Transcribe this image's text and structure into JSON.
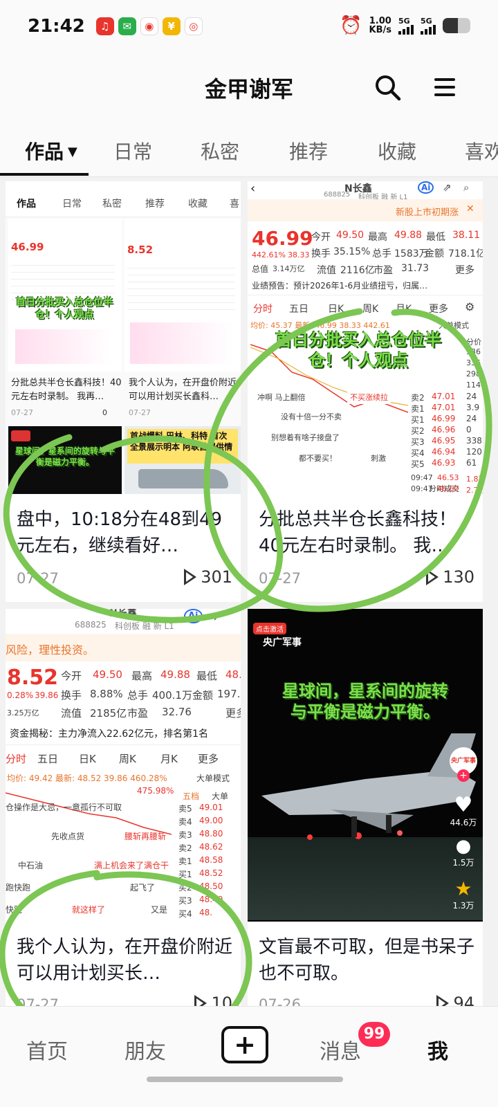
{
  "status_bar": {
    "time": "21:42",
    "net_speed_value": "1.00",
    "net_speed_unit": "KB/s",
    "signal_1": "5G",
    "signal_2": "5G",
    "battery_level": 0.55,
    "app_icons": [
      "qq-music-icon",
      "wechat-icon",
      "map-icon",
      "wallet-icon",
      "weibo-icon"
    ]
  },
  "header": {
    "title": "金甲谢军",
    "search_icon": "search-icon",
    "menu_icon": "menu-icon"
  },
  "tabs": [
    {
      "label": "作品",
      "active": true
    },
    {
      "label": "日常"
    },
    {
      "label": "私密"
    },
    {
      "label": "推荐"
    },
    {
      "label": "收藏"
    },
    {
      "label": "喜欢"
    }
  ],
  "videos": [
    {
      "caption": "盘中，10:18分在48到49元左右，继续看好…",
      "date": "07-27",
      "plays": "301",
      "thumb": {
        "mini_tabs": [
          "作品",
          "日常",
          "私密",
          "推荐",
          "收藏",
          "喜"
        ],
        "left": {
          "price": "46.99",
          "caption": "分批总共半仓长鑫科技！40元左右时录制。 我再…",
          "date": "07-27",
          "plays": "0",
          "overlay": "首日分批买入总仓位半仓！个人观点"
        },
        "right": {
          "price": "8.52",
          "caption": "我个人认为，在开盘价附近可以用计划买长鑫科…",
          "date": "07-27",
          "plays": ""
        },
        "bottom_left_text": "星球间，星系间的旋转与平衡是磁力平衡。",
        "bottom_right_text": "首战爆料 巴林、科特 首次全景展示明本 阿联酋提供情"
      }
    },
    {
      "caption": "分批总共半仓长鑫科技！40元左右时录制。 我…",
      "date": "07-27",
      "plays": "130",
      "thumb": {
        "stock_name": "N长鑫",
        "stock_code": "688825",
        "stock_tags": "科创板 融 新 L1",
        "ipo_notice": "新股上市初期涨",
        "price": "46.99",
        "change_pct": "442.61%",
        "change_abs": "38.33",
        "open_label": "今开",
        "open": "49.50",
        "high_label": "最高",
        "high": "49.88",
        "low_label": "最低",
        "low": "38.11",
        "turnover_label": "换手",
        "turnover": "35.15%",
        "volume_label": "总手",
        "volume": "1583万",
        "amount_label": "金额",
        "amount": "718.1亿",
        "mcap_label": "总值",
        "mcap": "3.14万亿",
        "float_label": "流值",
        "float_val": "2116亿",
        "pe_label": "市盈",
        "pe": "31.73",
        "more": "更多",
        "forecast": "业绩预告：预计2026年1-6月业绩扭亏，归属…",
        "chart_tabs": [
          "分时",
          "五日",
          "日K",
          "周K",
          "月K",
          "更多"
        ],
        "avg_line": "均价: 45.37 最新: 46.99 38.33 442.61",
        "overlay": "首日分批买入总仓位半仓！个人观点",
        "comments": [
          "冲啊 马上翻倍",
          "不买涨续拉",
          "没有十倍一分不卖",
          "别想着有啥子接盘了",
          "都不要买！",
          "刺激"
        ],
        "order_book": [
          {
            "label": "卖2",
            "price": "47.01",
            "vol": "24"
          },
          {
            "label": "卖1",
            "price": "47.01",
            "vol": "3.9"
          },
          {
            "label": "买1",
            "price": "46.99",
            "vol": "24"
          },
          {
            "label": "买2",
            "price": "46.96",
            "vol": "0"
          },
          {
            "label": "买3",
            "price": "46.95",
            "vol": "338"
          },
          {
            "label": "买4",
            "price": "46.94",
            "vol": "120"
          },
          {
            "label": "买5",
            "price": "46.93",
            "vol": "61"
          }
        ],
        "ticks_label": "分时成交",
        "ticks": [
          {
            "time": "09:47",
            "price": "46.53",
            "vol": "1.8万"
          },
          {
            "time": "09:47",
            "price": "46.60",
            "vol": "2.7万"
          }
        ],
        "big_order": "大单模式",
        "side_values": [
          "分价",
          "536",
          "336",
          "298",
          "114"
        ]
      }
    },
    {
      "caption": "我个人认为，在开盘价附近可以用计划买长…",
      "date": "07-27",
      "plays": "10",
      "thumb": {
        "stock_name": "N长鑫",
        "stock_code": "688825",
        "stock_tags": "科创板 融 新 L1",
        "risk_notice": "风险，理性投资。",
        "price": "8.52",
        "change_pct": "0.28%",
        "change_abs": "39.86",
        "open_label": "今开",
        "open": "49.50",
        "high_label": "最高",
        "high": "49.88",
        "low_label": "最低",
        "low": "48.",
        "turnover_label": "换手",
        "turnover": "8.88%",
        "volume_label": "总手",
        "volume": "400.1万",
        "amount_label": "金额",
        "amount": "197.7",
        "mcap": "3.25万亿",
        "float_label": "流值",
        "float_val": "2185亿",
        "pe_label": "市盈",
        "pe": "32.76",
        "more": "更多",
        "capital": "资金揭秘：主力净流入22.62亿元，排名第1名",
        "chart_tabs": [
          "分时",
          "五日",
          "日K",
          "周K",
          "月K",
          "更多"
        ],
        "avg_line": "均价: 49.42 最新: 48.52 39.86 460.28%",
        "pct_mark": "475.98%",
        "five_label": "五档",
        "comments": [
          "仓操作是大忌，一意孤行不可取",
          "先收点货",
          "腰斩再腰斩",
          "中石油",
          "满上机会来了满仓干",
          "跑快跑",
          "起飞了",
          "快跑",
          "就这样了",
          "又是"
        ],
        "order_book": [
          {
            "label": "卖5",
            "price": "49.01"
          },
          {
            "label": "卖4",
            "price": "49.00"
          },
          {
            "label": "卖3",
            "price": "48.80"
          },
          {
            "label": "卖2",
            "price": "48.62"
          },
          {
            "label": "卖1",
            "price": "48.58"
          },
          {
            "label": "买1",
            "price": "48.52"
          },
          {
            "label": "买2",
            "price": "48.50"
          },
          {
            "label": "买3",
            "price": "48.49"
          },
          {
            "label": "买4",
            "price": "48."
          }
        ],
        "big_order": "大单模式",
        "big_label": "大单"
      }
    },
    {
      "caption": "文盲最不可取，但是书呆子也不可取。",
      "date": "07-26",
      "plays": "94",
      "thumb": {
        "badge_top": "点击激活",
        "channel": "央广军事",
        "overlay": "星球间，星系间的旋转与平衡是磁力平衡。",
        "avatar_label": "央广军事",
        "likes": "44.6万",
        "comments": "1.5万",
        "favorites": "1.3万"
      }
    }
  ],
  "bottom_nav": {
    "home": "首页",
    "friends": "朋友",
    "plus": "+",
    "messages": "消息",
    "messages_badge": "99",
    "me": "我"
  },
  "colors": {
    "accent_red": "#fe2c55",
    "stock_red": "#e8342c",
    "stock_green": "#1a9c4a",
    "annotation_green": "#7cc653"
  }
}
